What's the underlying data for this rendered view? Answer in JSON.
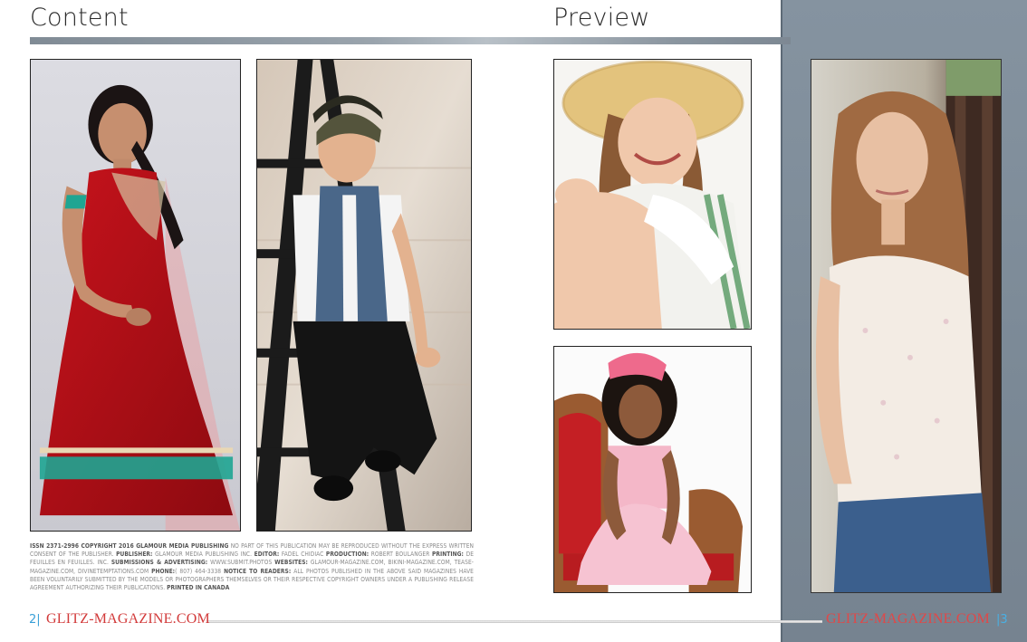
{
  "headings": {
    "content": "Content",
    "preview": "Preview"
  },
  "credits": [
    {
      "bold": true,
      "text": "ISSN 2371-2996 COPYRIGHT 2016 GLAMOUR MEDIA PUBLISHING"
    },
    {
      "bold": false,
      "text": " NO PART OF THIS PUBLICATION MAY BE REPRODUCED WITHOUT THE EXPRESS WRITTEN CONSENT OF THE PUBLISHER. "
    },
    {
      "bold": true,
      "text": "PUBLISHER:"
    },
    {
      "bold": false,
      "text": " GLAMOUR MEDIA PUBLISHING INC. "
    },
    {
      "bold": true,
      "text": "EDITOR:"
    },
    {
      "bold": false,
      "text": " FADEL CHIDIAC "
    },
    {
      "bold": true,
      "text": "PRODUCTION:"
    },
    {
      "bold": false,
      "text": " ROBERT BOULANGER "
    },
    {
      "bold": true,
      "text": "PRINTING:"
    },
    {
      "bold": false,
      "text": " DE FEUILLES EN FEUILLES. INC. "
    },
    {
      "bold": true,
      "text": "SUBMISSIONS & ADVERTISING:"
    },
    {
      "bold": false,
      "text": " WWW.SUBMIT.PHOTOS "
    },
    {
      "bold": true,
      "text": "WEBSITES:"
    },
    {
      "bold": false,
      "text": " GLAMOUR-MAGAZINE.COM, BIKINI-MAGAZINE.COM, TEASE-MAGAZINE.COM, DIVINETEMPTATIONS.COM "
    },
    {
      "bold": true,
      "text": "PHONE:"
    },
    {
      "bold": false,
      "text": "( 807) 464-3338 "
    },
    {
      "bold": true,
      "text": "NOTICE TO READERS:"
    },
    {
      "bold": false,
      "text": " ALL PHOTOS PUBLISHED IN THE ABOVE SAID MAGAZINES HAVE BEEN VOLUNTARILY SUBMITTED BY THE MODELS OR PHOTOGRAPHERS THEMSELVES OR THEIR RESPECTIVE COPYRIGHT OWNERS UNDER A PUBLISHING RELEASE AGREEMENT AUTHORIZING THEIR PUBLICATIONS. "
    },
    {
      "bold": true,
      "text": "PRINTED IN CANADA"
    }
  ],
  "footer": {
    "left_page": "2|",
    "right_page": "|3",
    "brand_left": "GLITZ-MAGAZINE.COM",
    "brand_right": "GLITZ-MAGAZINE.COM"
  },
  "colors": {
    "brand_red": "#d23a3a",
    "page_number_blue": "#3aa0d8",
    "side_panel": "#7f8c99"
  },
  "photos": [
    {
      "name": "photo-woman-red-dress"
    },
    {
      "name": "photo-boy-denim-vest"
    },
    {
      "name": "photo-girl-straw-hat"
    },
    {
      "name": "photo-girl-pink-dress"
    },
    {
      "name": "photo-girl-long-hair"
    }
  ]
}
